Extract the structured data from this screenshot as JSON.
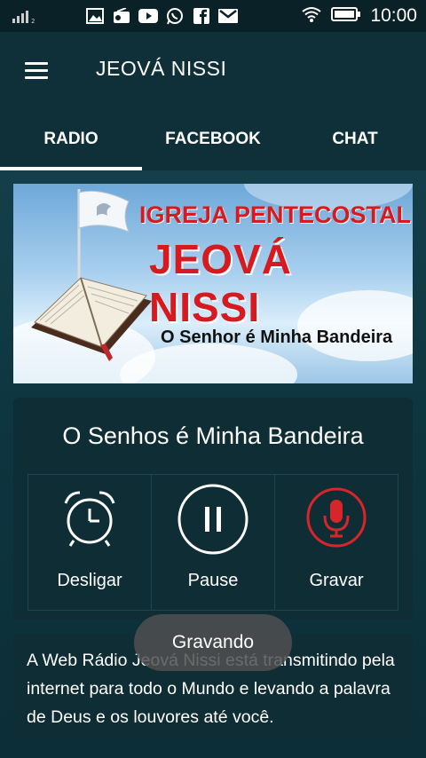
{
  "status_bar": {
    "time": "10:00",
    "icons": [
      "signal-icon",
      "gallery-icon",
      "radio-icon",
      "youtube-icon",
      "whatsapp-icon",
      "facebook-icon",
      "gmail-icon",
      "wifi-icon",
      "battery-icon"
    ]
  },
  "app_bar": {
    "title": "JEOVÁ NISSI",
    "menu_icon": "hamburger-icon"
  },
  "tabs": [
    {
      "label": "RADIO",
      "active": true
    },
    {
      "label": "FACEBOOK",
      "active": false
    },
    {
      "label": "CHAT",
      "active": false
    }
  ],
  "banner": {
    "line1": "IGREJA PENTECOSTAL",
    "line2": "JEOVÁ NISSI",
    "line3": "O Senhor é Minha Bandeira"
  },
  "player": {
    "title": "O Senhos é Minha Bandeira",
    "buttons": [
      {
        "label": "Desligar",
        "icon": "alarm-clock-icon"
      },
      {
        "label": "Pause",
        "icon": "pause-icon"
      },
      {
        "label": "Gravar",
        "icon": "microphone-icon"
      }
    ]
  },
  "description": "A Web Rádio Jeová Nissi está transmitindo pela internet para todo o Mundo e levando a palavra de Deus e os louvores até você.",
  "toast": "Gravando",
  "colors": {
    "recording_red": "#d7262a",
    "toolbar": "#0f3038"
  }
}
